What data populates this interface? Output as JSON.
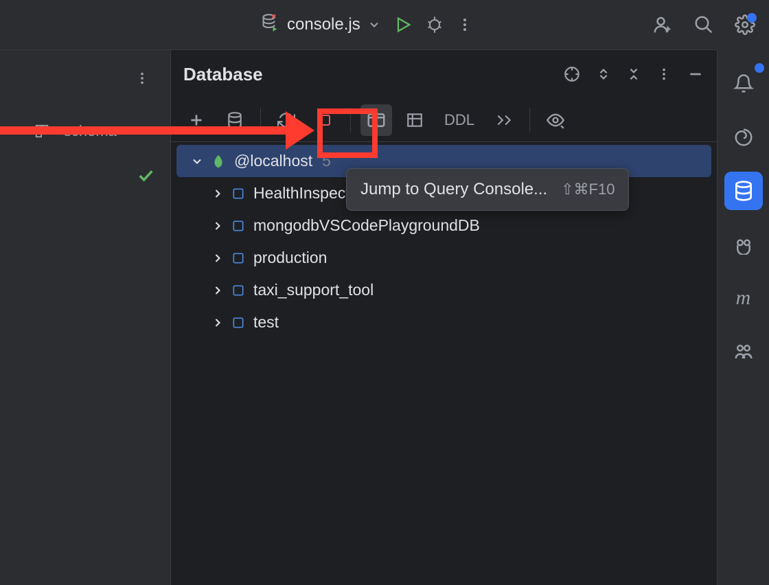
{
  "topbar": {
    "filename": "console.js"
  },
  "panel": {
    "title": "Database"
  },
  "toolbar": {
    "ddl_label": "DDL"
  },
  "tree": {
    "root": {
      "label": "@localhost",
      "count": "5"
    },
    "children": [
      {
        "label": "HealthInspections"
      },
      {
        "label": "mongodbVSCodePlaygroundDB"
      },
      {
        "label": "production"
      },
      {
        "label": "taxi_support_tool"
      },
      {
        "label": "test"
      }
    ]
  },
  "tooltip": {
    "text": "Jump to Query Console...",
    "shortcut": "⇧⌘F10"
  },
  "left": {
    "schema_label": "<schema>"
  }
}
